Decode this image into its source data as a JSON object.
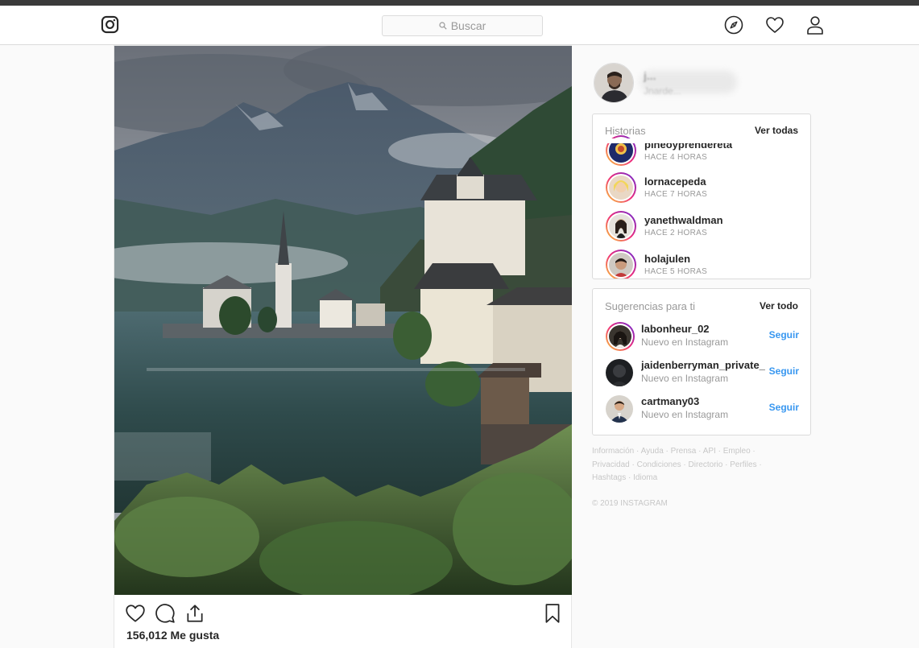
{
  "nav": {
    "search_placeholder": "Buscar",
    "logo_icon": "instagram-logo-icon",
    "icons": [
      "compass-icon",
      "heart-icon",
      "profile-icon"
    ]
  },
  "post": {
    "image": "photo of lakeside alpine village with church spire and mountains",
    "likes": "156,012 Me gusta",
    "action_icons": [
      "like-icon",
      "comment-icon",
      "share-icon",
      "save-icon"
    ]
  },
  "profile": {
    "username": "j...",
    "name": "Jnarde..."
  },
  "stories": {
    "title": "Historias",
    "see_all": "Ver todas",
    "items": [
      {
        "name": "pineoyprendereta",
        "time": "HACE 4 HORAS"
      },
      {
        "name": "lornacepeda",
        "time": "HACE 7 HORAS"
      },
      {
        "name": "yanethwaldman",
        "time": "HACE 2 HORAS"
      },
      {
        "name": "holajulen",
        "time": "HACE 5 HORAS"
      }
    ]
  },
  "suggestions": {
    "title": "Sugerencias para ti",
    "see_all": "Ver todo",
    "items": [
      {
        "name": "labonheur_02",
        "sub": "Nuevo en Instagram",
        "action": "Seguir"
      },
      {
        "name": "jaidenberryman_private_",
        "sub": "Nuevo en Instagram",
        "action": "Seguir"
      },
      {
        "name": "cartmany03",
        "sub": "Nuevo en Instagram",
        "action": "Seguir"
      }
    ]
  },
  "footer": {
    "links": [
      "Información",
      "Ayuda",
      "Prensa",
      "API",
      "Empleo",
      "Privacidad",
      "Condiciones",
      "Directorio",
      "Perfiles",
      "Hashtags",
      "Idioma"
    ],
    "copyright": "© 2019 INSTAGRAM"
  },
  "colors": {
    "accent": "#3897f0",
    "text": "#262626",
    "muted": "#999999",
    "border": "#dbdbdb",
    "background": "#fafafa"
  }
}
